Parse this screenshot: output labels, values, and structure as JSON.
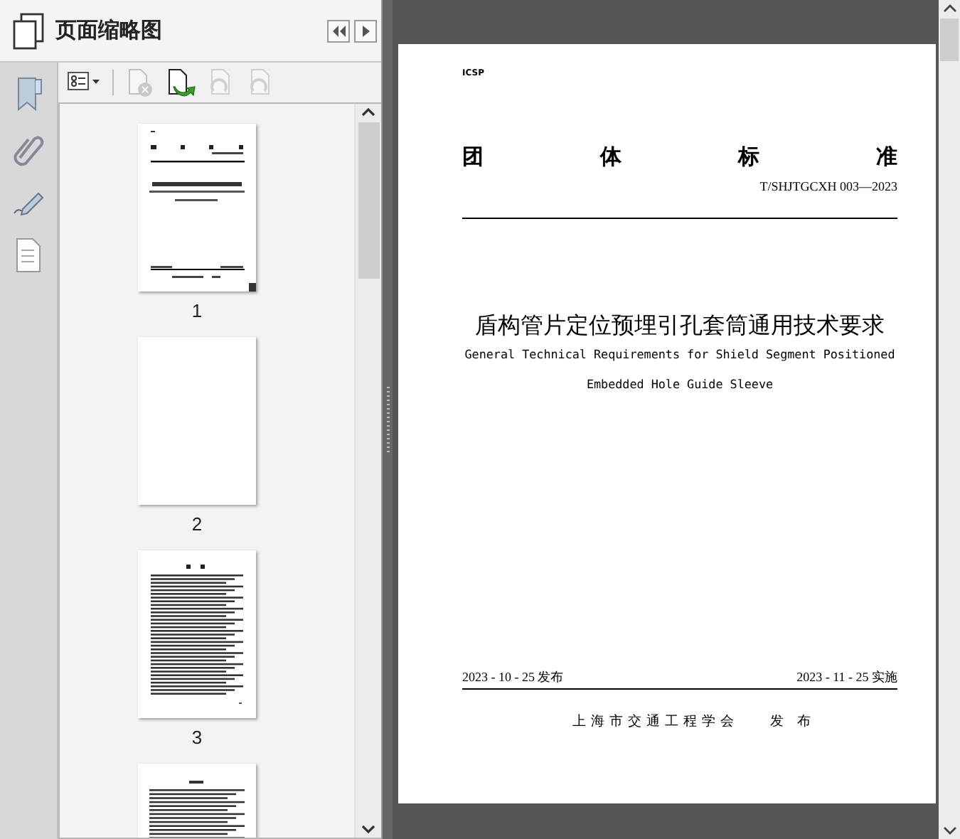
{
  "panel": {
    "title": "页面缩略图",
    "toolbar": [
      {
        "kind": "options",
        "disabled": false
      },
      {
        "kind": "delete",
        "disabled": true
      },
      {
        "kind": "replace",
        "disabled": false
      },
      {
        "kind": "rotate-left",
        "disabled": true
      },
      {
        "kind": "rotate-right",
        "disabled": true
      }
    ],
    "thumbnails": [
      {
        "kind": "cover",
        "label": "1"
      },
      {
        "kind": "blank",
        "label": "2"
      },
      {
        "kind": "contents",
        "label": "3"
      },
      {
        "kind": "text"
      }
    ]
  },
  "document": {
    "code_label": "ICSP",
    "category": [
      "团",
      "体",
      "标",
      "准"
    ],
    "standard_no": "T/SHJTGCXH 003—2023",
    "title": "盾构管片定位预埋引孔套筒通用技术要求",
    "title_en": [
      "General Technical Requirements for Shield Segment Positioned",
      "Embedded Hole Guide Sleeve"
    ],
    "issue_date": "2023 - 10 - 25 发布",
    "effective_date": "2023 - 11 - 25 实施",
    "publisher": "上海市交通工程学会",
    "publish_word": "发 布"
  }
}
